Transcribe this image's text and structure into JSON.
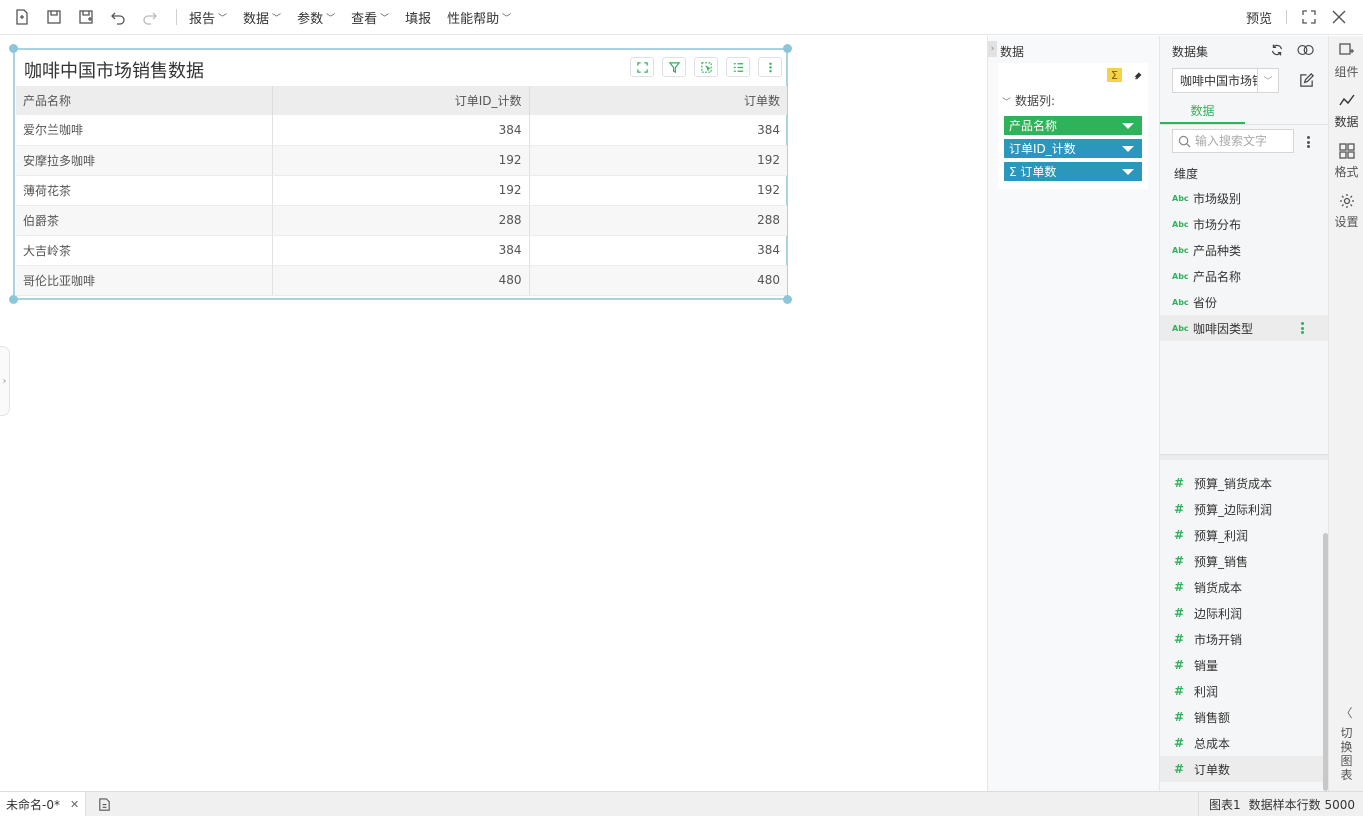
{
  "toolbar": {
    "menus": [
      {
        "label": "报告",
        "has_dropdown": true
      },
      {
        "label": "数据",
        "has_dropdown": true
      },
      {
        "label": "参数",
        "has_dropdown": true
      },
      {
        "label": "查看",
        "has_dropdown": true
      },
      {
        "label": "填报",
        "has_dropdown": false
      },
      {
        "label": "性能帮助",
        "has_dropdown": true
      }
    ],
    "preview_label": "预览"
  },
  "widget": {
    "title": "咖啡中国市场销售数据",
    "columns": [
      "产品名称",
      "订单ID_计数",
      "订单数"
    ],
    "rows": [
      [
        "爱尔兰咖啡",
        "384",
        "384"
      ],
      [
        "安摩拉多咖啡",
        "192",
        "192"
      ],
      [
        "薄荷花茶",
        "192",
        "192"
      ],
      [
        "伯爵茶",
        "288",
        "288"
      ],
      [
        "大吉岭茶",
        "384",
        "384"
      ],
      [
        "哥伦比亚咖啡",
        "480",
        "480"
      ]
    ]
  },
  "data_panel": {
    "title": "数据",
    "section_label": "数据列:",
    "sum_symbol": "Σ",
    "columns": [
      {
        "label": "产品名称",
        "color": "#2eb35a"
      },
      {
        "label": "订单ID_计数",
        "color": "#2c97bd"
      },
      {
        "label": "Σ 订单数",
        "color": "#2c97bd"
      }
    ]
  },
  "dataset_panel": {
    "title": "数据集",
    "selected_dataset": "咖啡中国市场销售数据",
    "tab_label": "数据",
    "search_placeholder": "输入搜索文字",
    "dimension_title": "维度",
    "abc_label": "Abc",
    "hash_label": "#",
    "dimensions": [
      "市场级别",
      "市场分布",
      "产品种类",
      "产品名称",
      "省份",
      "咖啡因类型"
    ],
    "measures": [
      "预算_销货成本",
      "预算_边际利润",
      "预算_利润",
      "预算_销售",
      "销货成本",
      "边际利润",
      "市场开销",
      "销量",
      "利润",
      "销售额",
      "总成本",
      "订单数"
    ]
  },
  "rail": {
    "items": [
      "组件",
      "数据",
      "格式",
      "设置"
    ],
    "switch_label": [
      "切",
      "换",
      "图",
      "表"
    ]
  },
  "status": {
    "tab_label": "未命名-0*",
    "chart_label": "图表1",
    "sample_rows": "数据样本行数 5000"
  },
  "colors": {
    "accent": "#2eb35a",
    "measure_blue": "#2c97bd",
    "widget_border": "#a9d3e2"
  }
}
